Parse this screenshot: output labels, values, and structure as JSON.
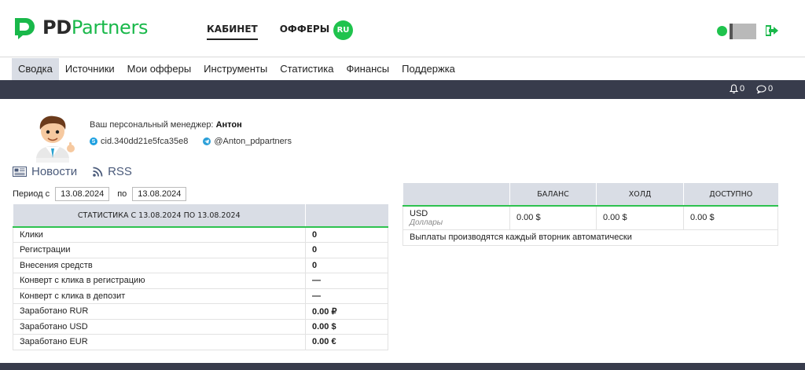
{
  "header": {
    "logo_pd": "PD",
    "logo_partners": "Partners",
    "nav": [
      {
        "label": "КАБИНЕТ",
        "active": true
      },
      {
        "label": "ОФФЕРЫ",
        "active": false
      }
    ],
    "lang": "RU",
    "status_color": "#1fc34d"
  },
  "menu": [
    {
      "label": "Сводка",
      "active": true
    },
    {
      "label": "Источники"
    },
    {
      "label": "Мои офферы"
    },
    {
      "label": "Инструменты"
    },
    {
      "label": "Статистика"
    },
    {
      "label": "Финансы"
    },
    {
      "label": "Поддержка"
    }
  ],
  "notifications": {
    "bell_count": "0",
    "chat_count": "0"
  },
  "manager": {
    "label": "Ваш персональный менеджер:",
    "name": "Антон",
    "skype": "cid.340dd21e5fca35e8",
    "telegram": "@Anton_pdpartners"
  },
  "links": {
    "news": "Новости",
    "rss": "RSS"
  },
  "period": {
    "from_label": "Период с",
    "from": "13.08.2024",
    "to_label": "по",
    "to": "13.08.2024"
  },
  "stats": {
    "header": "СТАТИСТИКА С 13.08.2024 ПО 13.08.2024",
    "rows": [
      {
        "label": "Клики",
        "value": "0"
      },
      {
        "label": "Регистрации",
        "value": "0"
      },
      {
        "label": "Внесения средств",
        "value": "0"
      },
      {
        "label": "Конверт с клика в регистрацию",
        "value": "—"
      },
      {
        "label": "Конверт с клика в депозит",
        "value": "—"
      },
      {
        "label": "Заработано RUR",
        "value": "0.00 ₽"
      },
      {
        "label": "Заработано USD",
        "value": "0.00 $"
      },
      {
        "label": "Заработано EUR",
        "value": "0.00 €"
      }
    ]
  },
  "finance": {
    "headers": [
      "БАЛАНС",
      "ХОЛД",
      "ДОСТУПНО"
    ],
    "currency": "USD",
    "currency_sub": "Доллары",
    "balance": "0.00 $",
    "hold": "0.00 $",
    "available": "0.00 $",
    "note": "Выплаты производятся каждый вторник автоматически"
  },
  "colors": {
    "accent": "#1fc34d",
    "dark": "#383c4c",
    "table_head": "#d9dde5"
  }
}
